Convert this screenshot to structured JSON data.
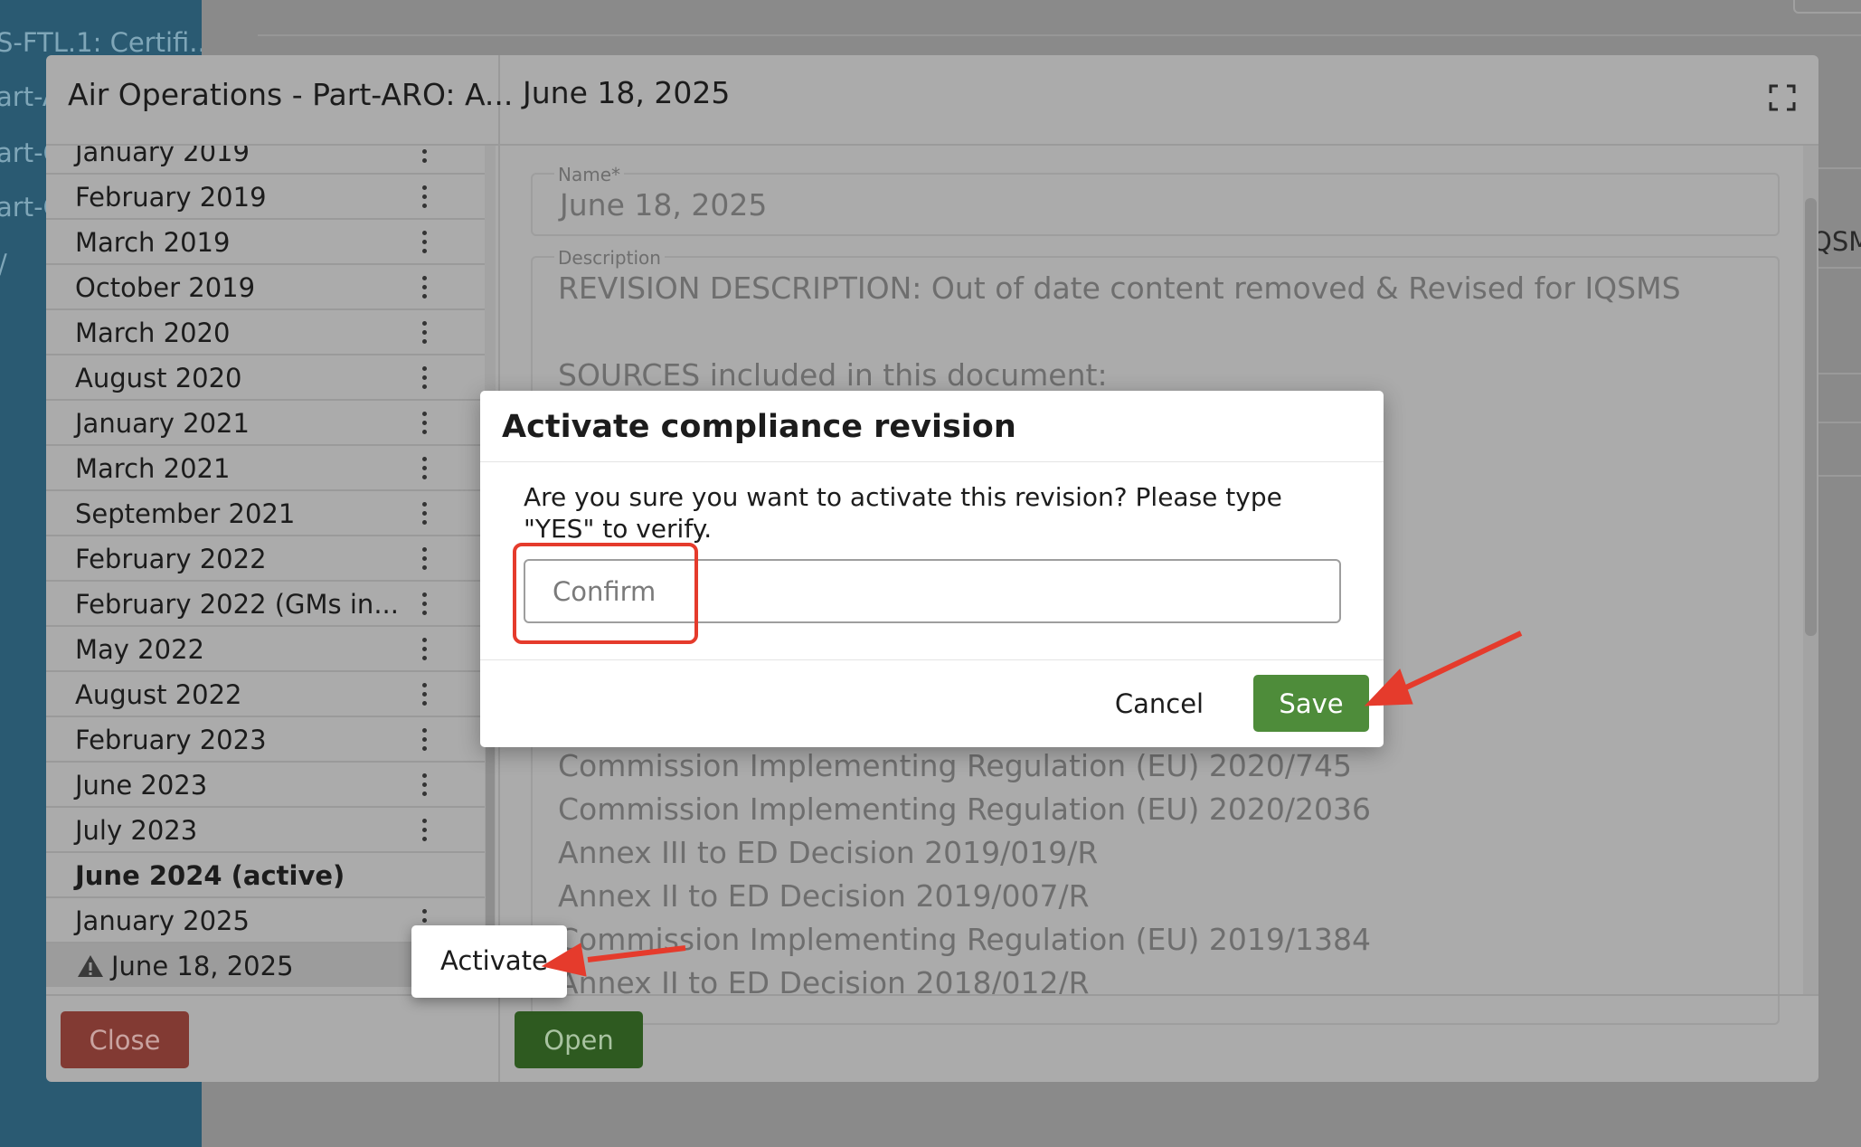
{
  "background": {
    "sidebar_items": [
      "S-FTL.1: Certifi...",
      "art-A",
      "art-C",
      "art-C",
      "/"
    ],
    "right_fragment": "QSM"
  },
  "outer_modal": {
    "left_title": "Air Operations - Part-ARO: A...",
    "revisions": [
      {
        "label": "January 2019",
        "menu": true
      },
      {
        "label": "February 2019",
        "menu": true
      },
      {
        "label": "March 2019",
        "menu": true
      },
      {
        "label": "October 2019",
        "menu": true
      },
      {
        "label": "March 2020",
        "menu": true
      },
      {
        "label": "August 2020",
        "menu": true
      },
      {
        "label": "January 2021",
        "menu": true
      },
      {
        "label": "March 2021",
        "menu": true
      },
      {
        "label": "September 2021",
        "menu": true
      },
      {
        "label": "February 2022",
        "menu": true
      },
      {
        "label": "February 2022 (GMs in...",
        "menu": true
      },
      {
        "label": "May 2022",
        "menu": true
      },
      {
        "label": "August 2022",
        "menu": true
      },
      {
        "label": "February 2023",
        "menu": true
      },
      {
        "label": "June 2023",
        "menu": true
      },
      {
        "label": "July 2023",
        "menu": true
      },
      {
        "label": "June 2024 (active)",
        "menu": false,
        "bold": true
      },
      {
        "label": "January 2025",
        "menu": true
      },
      {
        "label": "June 18, 2025",
        "menu": false,
        "selected": true,
        "warning": true
      }
    ],
    "close_label": "Close",
    "open_label": "Open",
    "right_title": "June 18, 2025",
    "name_label": "Name*",
    "name_value": "June 18, 2025",
    "description_label": "Description",
    "description_lines": [
      "REVISION DESCRIPTION: Out of date content removed & Revised for IQSMS",
      "",
      "SOURCES included in this document:"
    ],
    "source_lines": [
      "Commission Implementing Regulation (EU) 2020/745",
      "Commission Implementing Regulation (EU) 2020/2036",
      "Annex III to ED Decision 2019/019/R",
      "Annex II to ED Decision 2019/007/R",
      "Commission Implementing Regulation (EU) 2019/1384",
      "Annex II to ED Decision 2018/012/R"
    ]
  },
  "context_menu": {
    "activate_label": "Activate"
  },
  "dialog": {
    "title": "Activate compliance revision",
    "message": "Are you sure you want to activate this revision? Please type \"YES\" to verify.",
    "input_placeholder": "Confirm",
    "input_value": "",
    "cancel_label": "Cancel",
    "save_label": "Save"
  },
  "colors": {
    "save_green": "#4e8c3a",
    "close_red": "#823a33",
    "annotation_red": "#e53b2c",
    "sidebar_teal": "#2a5a72"
  },
  "icons": [
    "expand-icon",
    "kebab-menu-icon",
    "warning-icon"
  ]
}
